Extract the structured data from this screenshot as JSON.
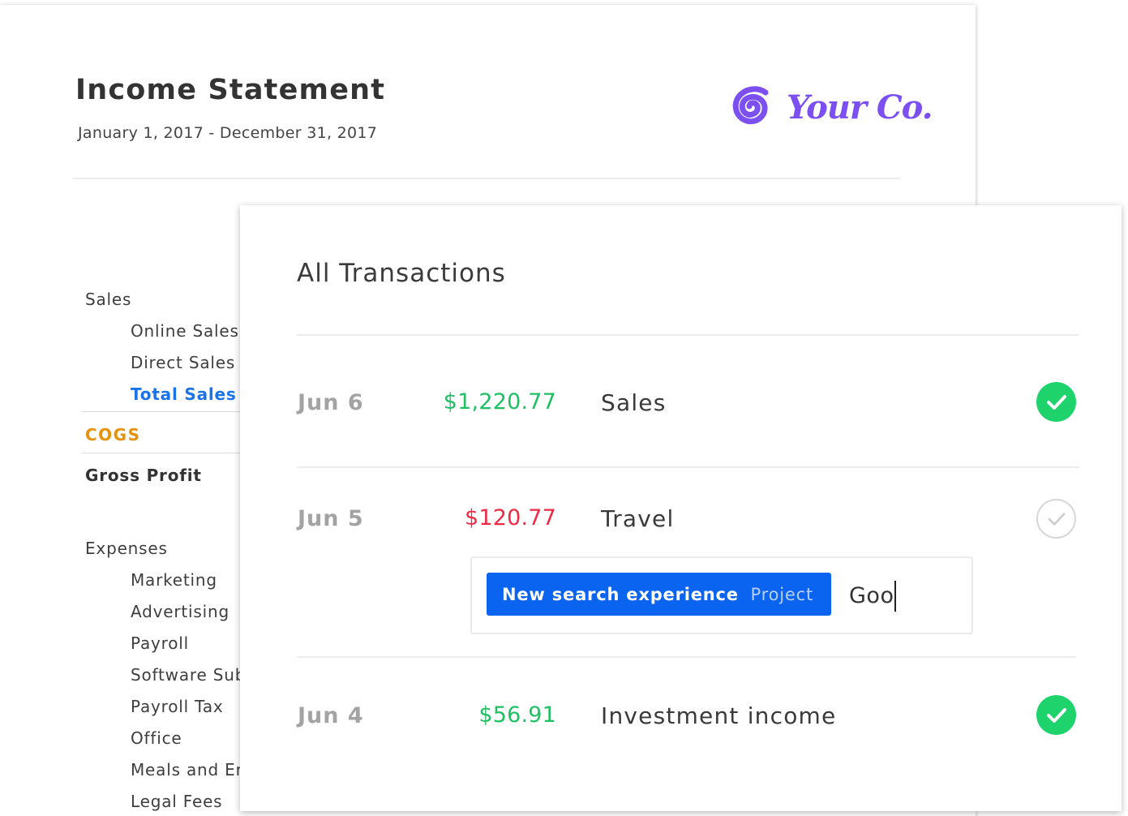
{
  "statement": {
    "title": "Income Statement",
    "date_range": "January 1, 2017 - December 31, 2017",
    "logo": {
      "text": "Your Co.",
      "icon": "spiral-icon",
      "color": "#7b4ff0"
    },
    "sales_heading": "Sales",
    "sales_items": [
      "Online Sales",
      "Direct Sales"
    ],
    "total_sales": "Total Sales",
    "cogs": "COGS",
    "gross_profit": "Gross Profit",
    "expenses_heading": "Expenses",
    "expense_items": [
      "Marketing",
      "Advertising",
      "Payroll",
      "Software Sub",
      "Payroll Tax",
      "Office",
      "Meals and Er",
      "Legal Fees"
    ]
  },
  "transactions": {
    "title": "All Transactions",
    "rows": [
      {
        "date": "Jun 6",
        "amount": "$1,220.77",
        "amount_color": "#1fbf63",
        "description": "Sales",
        "status": "reconciled",
        "icon": "check-circle-filled-icon"
      },
      {
        "date": "Jun 5",
        "amount": "$120.77",
        "amount_color": "#ef2a46",
        "description": "Travel",
        "status": "unreconciled",
        "icon": "check-circle-outline-icon"
      },
      {
        "date": "Jun 4",
        "amount": "$56.91",
        "amount_color": "#1fbf63",
        "description": "Investment income",
        "status": "reconciled",
        "icon": "check-circle-filled-icon"
      }
    ],
    "tag_editor": {
      "chip_name": "New search experience",
      "chip_type": "Project",
      "input_value": "Goo"
    }
  },
  "colors": {
    "accent_blue": "#0a64f0",
    "success_green": "#1ed36b",
    "total_blue": "#1a73e8",
    "cogs_orange": "#e6920b"
  }
}
